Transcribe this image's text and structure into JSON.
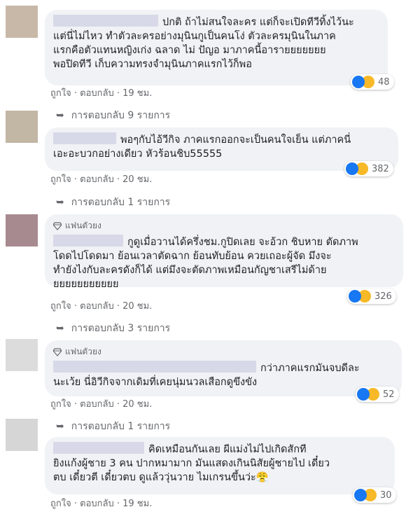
{
  "colors": {
    "bubble": "#f0f2f5",
    "meta": "#65676b",
    "like": "#1877f2",
    "haha": "#f7b928"
  },
  "comments": [
    {
      "avatar_color": "#c8b8a8",
      "badge": "",
      "lines": "ปกติ ถ้าไม่สนใจละคร แต่ก็จะเปิดทีวีทิ้งไว้นะ\nแต่นี่ไม่ไหว ทำตัวละครอย่างมุนินกูเป็นคนโง่ ตัวละครมุนินในภาค\nแรกคือตัวแทนหญิงเก่ง ฉลาด ไม่ ปัญอ มาภาคนี้อารายยยยยยย\nพอปิดทีวี เก็บความทรงจำมุนินภาคแรกไว้ก็พอ",
      "like": "ถูกใจ",
      "reply": "ตอบกลับ",
      "time": "19 ชม.",
      "reaction_count": "48",
      "replies_text": "การตอบกลับ 9 รายการ"
    },
    {
      "avatar_color": "#c2b6a4",
      "badge": "",
      "lines": "พอๆกับไอ้วีกิจ ภาคแรกออกจะเป็นคนใจเย็น แต่ภาคนี่\nเอะอะบวกอย่างเดียว หัวร้อนชิบ55555",
      "like": "ถูกใจ",
      "reply": "ตอบกลับ",
      "time": "20 ชม.",
      "reaction_count": "382",
      "replies_text": "การตอบกลับ 1 รายการ"
    },
    {
      "avatar_color": "#a78a90",
      "badge": "แฟนตัวยง",
      "lines": "กูดูเมื่อวานได้ครึ่งชม.กูปิดเลย จะอ้วก ชิบหาย ตัดภาพ\nโดดไปโดดมา ย้อนเวลาตัดฉาก ย้อนทับย้อน ควยเถอะผู้จัด มึงจะ\nทำยังไงกับละครดังก็ได้ แต่มึงจะตัดภาพเหมือนกัญชาเสรีไม่ด้าย\nยยยยยยยยยยย",
      "like": "ถูกใจ",
      "reply": "ตอบกลับ",
      "time": "20 ชม.",
      "reaction_count": "326",
      "replies_text": "การตอบกลับ 3 รายการ"
    },
    {
      "avatar_color": "#dcdcdc",
      "badge": "แฟนตัวยง",
      "lines": "กว่าภาคแรกมันจบดีละ\nนะเว้ย นี่อิวีกิจจากเดิมที่เคยนุ่มนวลเสือกดูขึงขัง",
      "like": "ถูกใจ",
      "reply": "ตอบกลับ",
      "time": "20 ชม.",
      "reaction_count": "52",
      "replies_text": "การตอบกลับ 1 รายการ"
    },
    {
      "avatar_color": "#d6d6d6",
      "badge": "",
      "lines": "คิดเหมือนกันเลย ผีแม่งไม่ไปเกิดสักที\nยิงแก้งผู้ชาย 3 คน ปากหมามาก มันแสดงเกินนิสัยผู้ชายไป เดี๋ยว\nตบ เดี๋ยวตี เดี๋ยวตบ ดูแล้ววุ่นวาย ไมเกรนขึ้นว่ะ😤",
      "like": "ถูกใจ",
      "reply": "ตอบกลับ",
      "time": "19 ชม.",
      "reaction_count": "30",
      "replies_text": ""
    }
  ]
}
